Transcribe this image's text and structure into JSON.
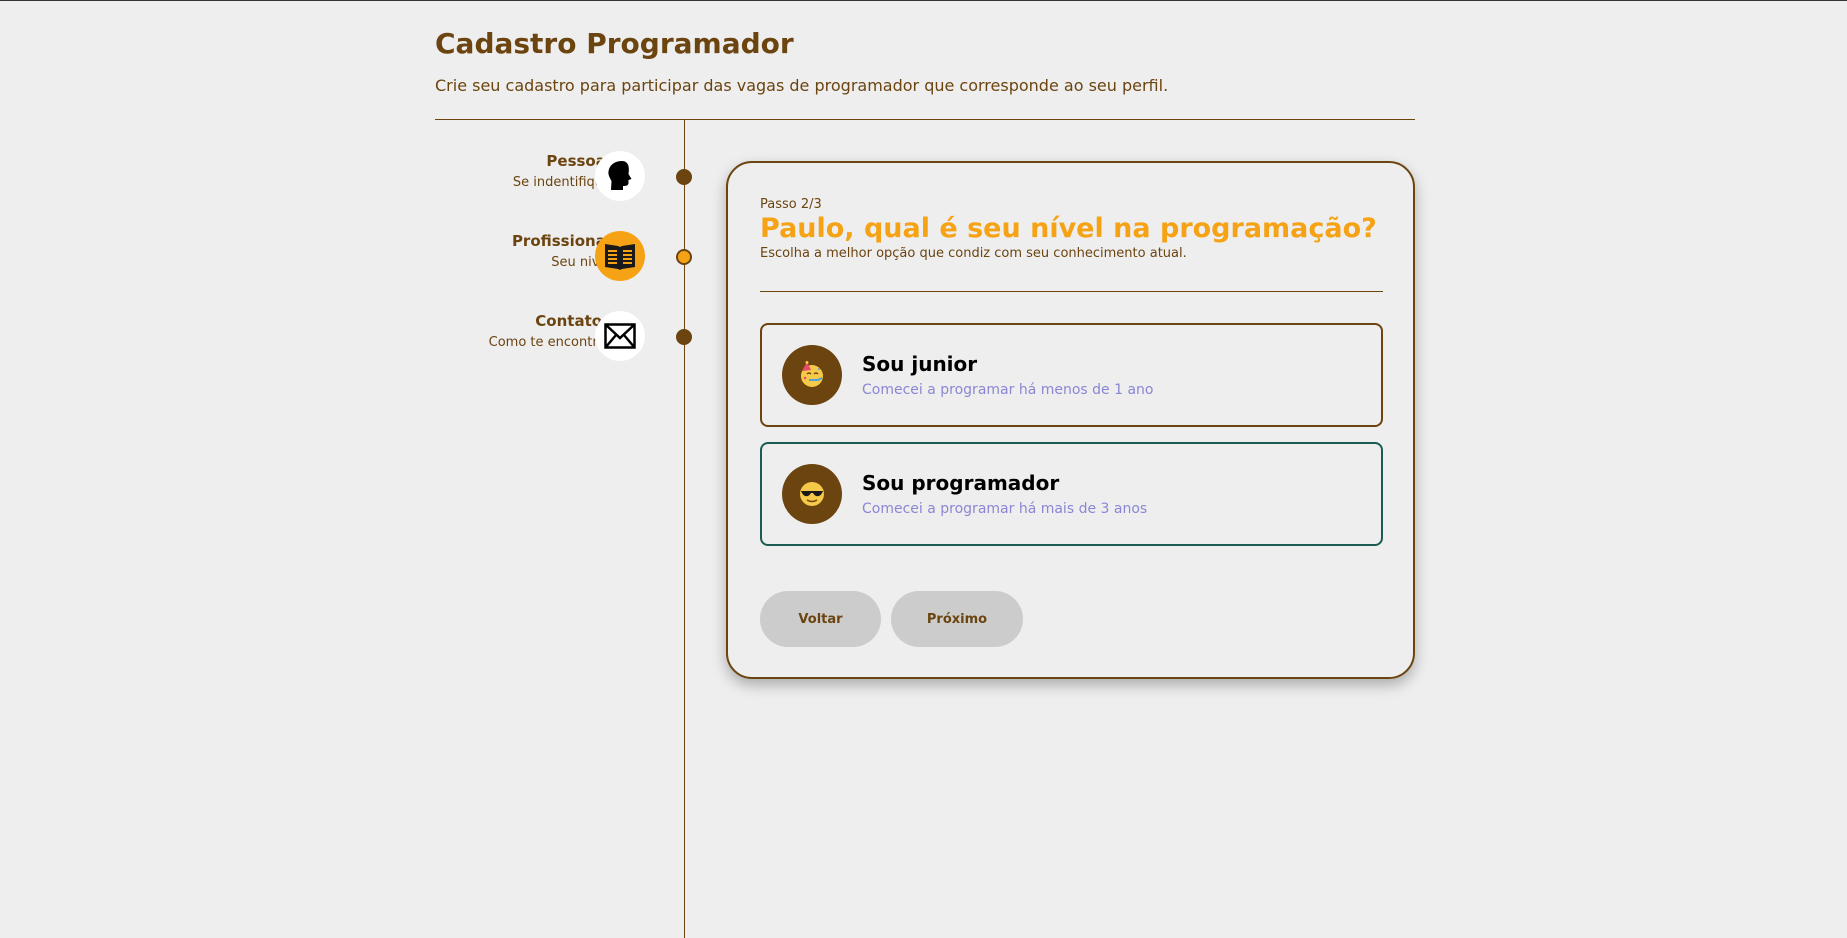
{
  "header": {
    "title": "Cadastro Programador",
    "subtitle": "Crie seu cadastro para participar das vagas de programador que corresponde ao seu perfil."
  },
  "steps": [
    {
      "title": "Pessoal",
      "subtitle": "Se indentifique",
      "icon": "head-silhouette-icon",
      "active": false
    },
    {
      "title": "Profissional",
      "subtitle": "Seu nivel",
      "icon": "book-icon",
      "active": true
    },
    {
      "title": "Contatos",
      "subtitle": "Como te encontrar",
      "icon": "envelope-icon",
      "active": false
    }
  ],
  "card": {
    "step_label": "Passo 2/3",
    "title": "Paulo, qual é seu nível na programação?",
    "description": "Escolha a melhor opção que condiz com seu conhecimento atual.",
    "options": [
      {
        "title": "Sou junior",
        "subtitle": "Comecei a programar há menos de 1 ano",
        "icon": "party-face-icon",
        "selected": false
      },
      {
        "title": "Sou programador",
        "subtitle": "Comecei a programar há mais de 3 anos",
        "icon": "sunglasses-face-icon",
        "selected": true
      }
    ],
    "back_label": "Voltar",
    "next_label": "Próximo"
  },
  "colors": {
    "brown": "#6b4410",
    "orange": "#f5a315",
    "background": "#eeeeee",
    "selected_border": "#1a5c52",
    "option_subtitle": "#8a87d4"
  }
}
